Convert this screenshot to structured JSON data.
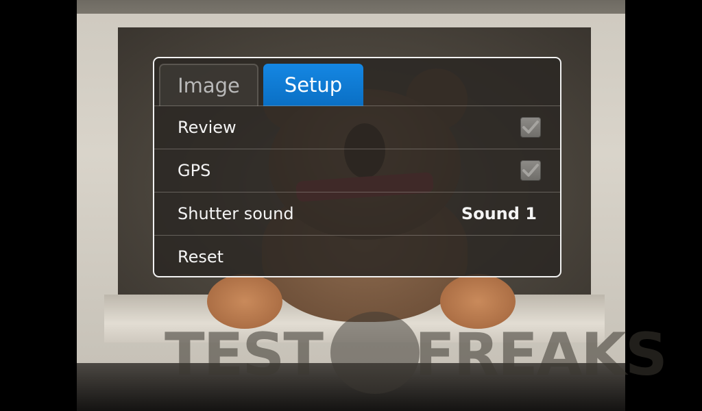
{
  "tabs": [
    {
      "label": "Image",
      "selected": false
    },
    {
      "label": "Setup",
      "selected": true
    }
  ],
  "settings": {
    "review": {
      "label": "Review",
      "checked": true
    },
    "gps": {
      "label": "GPS",
      "checked": true
    },
    "shutter_sound": {
      "label": "Shutter sound",
      "value": "Sound 1"
    },
    "reset": {
      "label": "Reset"
    }
  },
  "watermark": {
    "left": "TEST",
    "right": "FREAKS"
  },
  "colors": {
    "active_tab": "#0a78d4",
    "panel_background": "#2a2622",
    "panel_border": "#f2f2f2",
    "checkbox": "#7e7c78"
  },
  "icons": [
    "checkmark-icon",
    "checkmark-icon"
  ]
}
